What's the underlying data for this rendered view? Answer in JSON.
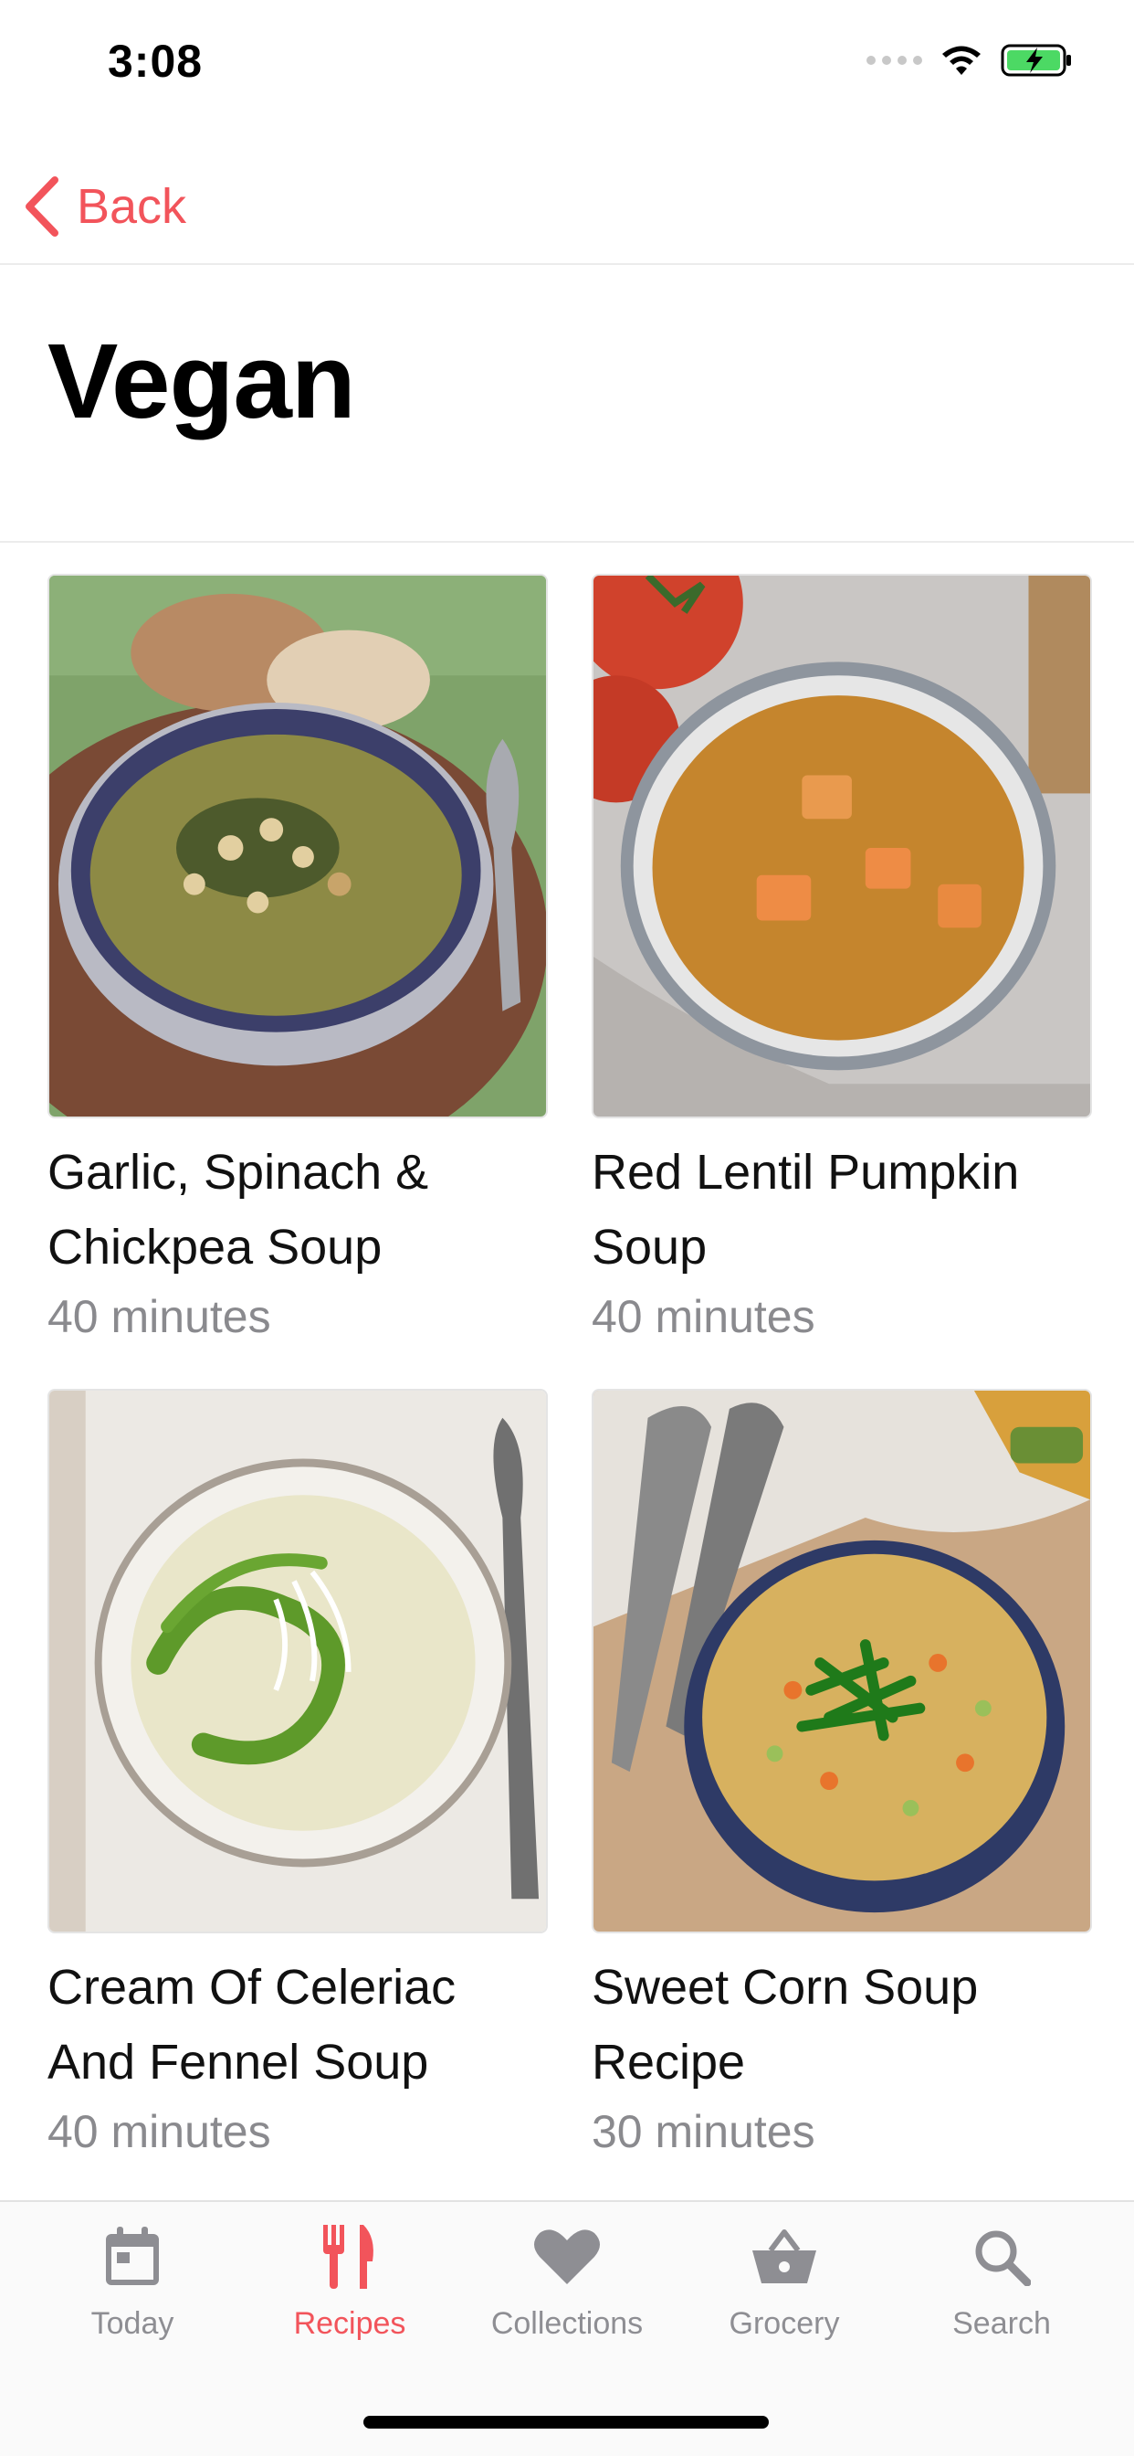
{
  "status": {
    "time": "3:08"
  },
  "nav": {
    "back_label": "Back"
  },
  "page": {
    "title": "Vegan"
  },
  "recipes": [
    {
      "title_line1": "Garlic, Spinach &",
      "title_line2": "Chickpea Soup",
      "time": "40 minutes"
    },
    {
      "title_line1": "Red Lentil Pumpkin",
      "title_line2": "Soup",
      "time": "40 minutes"
    },
    {
      "title_line1": "Cream Of Celeriac",
      "title_line2": "And Fennel Soup",
      "time": "40 minutes"
    },
    {
      "title_line1": "Sweet Corn Soup",
      "title_line2": "Recipe",
      "time": "30 minutes"
    }
  ],
  "tabs": [
    {
      "label": "Today",
      "icon": "calendar-icon"
    },
    {
      "label": "Recipes",
      "icon": "fork-knife-icon",
      "active": true
    },
    {
      "label": "Collections",
      "icon": "heart-icon"
    },
    {
      "label": "Grocery",
      "icon": "basket-icon"
    },
    {
      "label": "Search",
      "icon": "search-icon"
    }
  ],
  "colors": {
    "accent": "#f2545b",
    "inactive": "#8e8e93",
    "battery": "#4cd964"
  }
}
